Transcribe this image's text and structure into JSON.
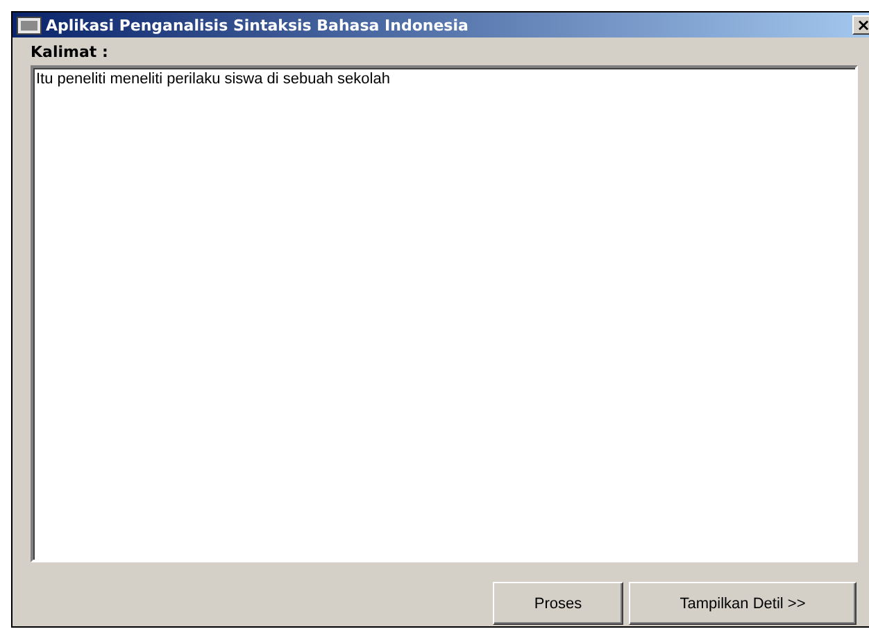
{
  "window": {
    "title": "Aplikasi Penganalisis Sintaksis Bahasa Indonesia",
    "close": "×"
  },
  "sentence": {
    "label": "Kalimat :",
    "value": "Itu peneliti meneliti perilaku siswa di sebuah sekolah"
  },
  "buttons": [
    "Proses",
    "Tampilkan Detil >>"
  ]
}
